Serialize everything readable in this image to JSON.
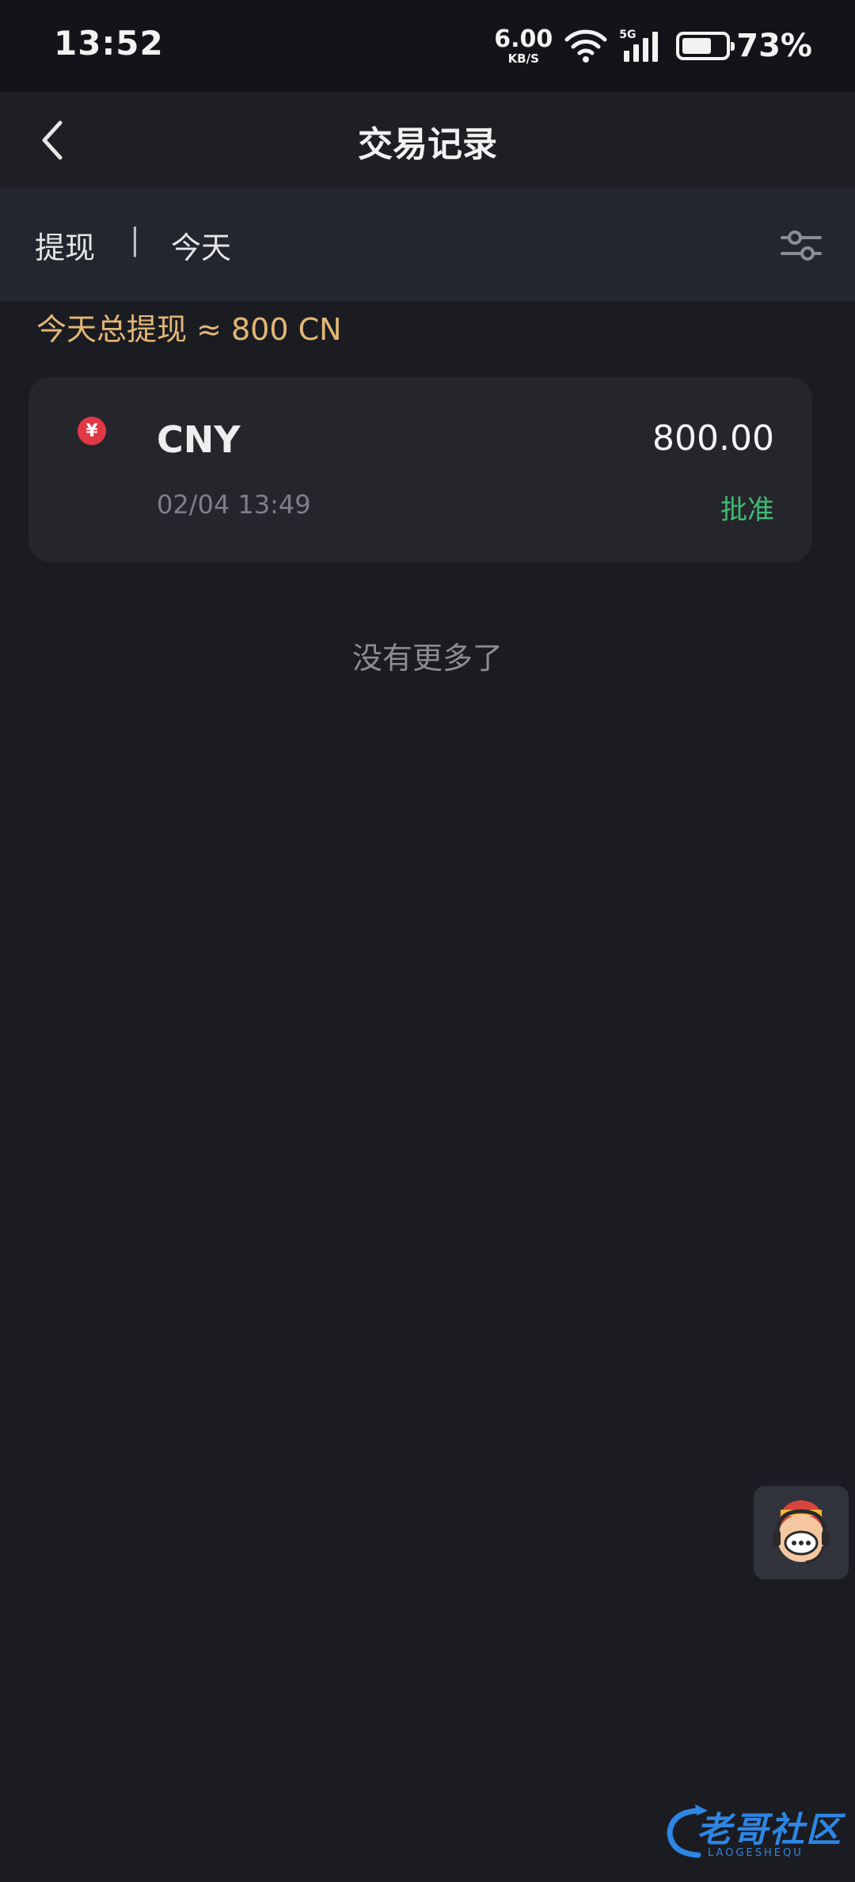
{
  "status_bar": {
    "time": "13:52",
    "net_speed_value": "6.00",
    "net_speed_unit": "KB/S",
    "network_type": "5G",
    "battery_percent": "73%",
    "battery_level": 0.73
  },
  "header": {
    "title": "交易记录",
    "back_icon": "chevron-left-icon"
  },
  "filter": {
    "type": "提现",
    "separator": "|",
    "date_range": "今天",
    "filter_icon": "sliders-icon"
  },
  "summary": {
    "text": "今天总提现 ≈ 800 CN"
  },
  "transactions": [
    {
      "icon": "yuan-coin-icon",
      "icon_symbol": "¥",
      "currency": "CNY",
      "amount": "800.00",
      "datetime": "02/04 13:49",
      "status": "批准",
      "status_color": "#3fbd74"
    }
  ],
  "list_end_text": "没有更多了",
  "support": {
    "icon": "customer-service-icon"
  },
  "watermark": {
    "text": "老哥社区",
    "subtext": "LAOGESHEQU"
  },
  "colors": {
    "background": "#1b1c21",
    "accent": "#e3b777",
    "approved": "#3fbd74",
    "coin": "#e03844"
  }
}
